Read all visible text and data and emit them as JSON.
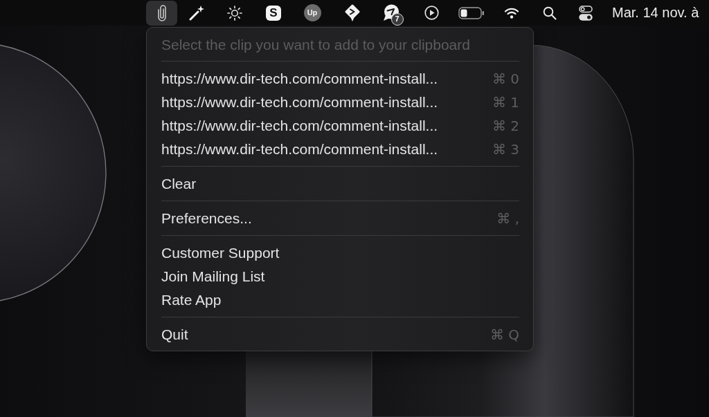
{
  "menubar": {
    "items": [
      {
        "kind": "paperclip",
        "selected": true
      },
      {
        "kind": "magic-wand",
        "selected": false
      },
      {
        "kind": "brightness",
        "selected": false
      },
      {
        "kind": "app-s",
        "label": "S",
        "selected": false
      },
      {
        "kind": "app-up",
        "label": "Up",
        "selected": false
      },
      {
        "kind": "diamond-arrow",
        "selected": false
      },
      {
        "kind": "chat-badge",
        "badge": "7",
        "selected": false
      },
      {
        "kind": "play",
        "selected": false
      },
      {
        "kind": "battery",
        "selected": false
      },
      {
        "kind": "wifi",
        "selected": false
      },
      {
        "kind": "search",
        "selected": false
      },
      {
        "kind": "control-center",
        "selected": false
      }
    ],
    "clock": "Mar. 14 nov. à"
  },
  "menu": {
    "header": "Select the clip you want to add to your clipboard",
    "sections": [
      {
        "items": [
          {
            "label": "https://www.dir-tech.com/comment-install...",
            "shortcut": "⌘ 0"
          },
          {
            "label": "https://www.dir-tech.com/comment-install...",
            "shortcut": "⌘ 1"
          },
          {
            "label": "https://www.dir-tech.com/comment-install...",
            "shortcut": "⌘ 2"
          },
          {
            "label": "https://www.dir-tech.com/comment-install...",
            "shortcut": "⌘ 3"
          }
        ]
      },
      {
        "items": [
          {
            "label": "Clear"
          }
        ]
      },
      {
        "items": [
          {
            "label": "Preferences...",
            "shortcut": "⌘ ,"
          }
        ]
      },
      {
        "items": [
          {
            "label": "Customer Support"
          },
          {
            "label": "Join Mailing List"
          },
          {
            "label": "Rate App"
          }
        ]
      },
      {
        "items": [
          {
            "label": "Quit",
            "shortcut": "⌘ Q"
          }
        ]
      }
    ]
  }
}
